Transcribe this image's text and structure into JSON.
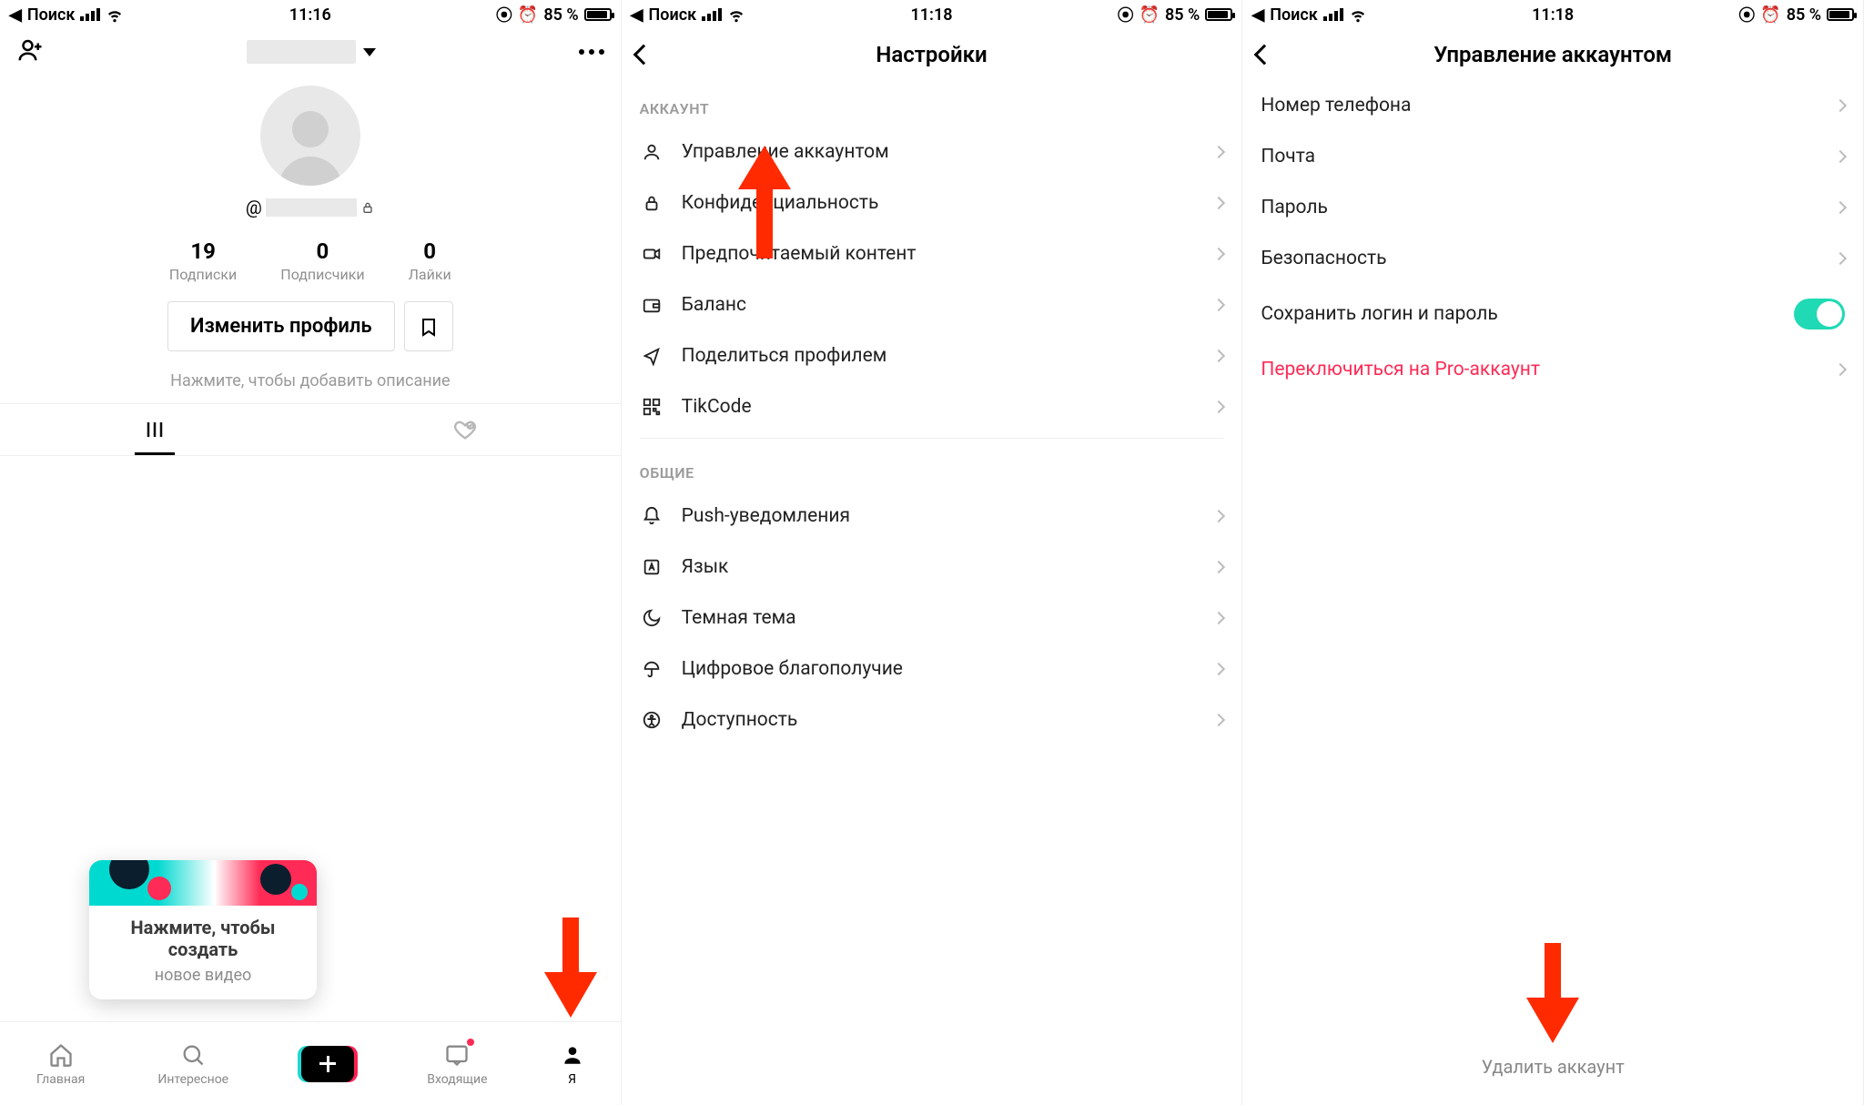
{
  "status": {
    "back_app": "Поиск",
    "battery_pct": "85 %",
    "s1_time": "11:16",
    "s2_time": "11:18",
    "s3_time": "11:18"
  },
  "s1": {
    "edit_profile": "Изменить профиль",
    "add_bio": "Нажмите, чтобы добавить описание",
    "handle_prefix": "@",
    "stats": {
      "following_num": "19",
      "following_lbl": "Подписки",
      "followers_num": "0",
      "followers_lbl": "Подписчики",
      "likes_num": "0",
      "likes_lbl": "Лайки"
    },
    "tip": {
      "line1a": "Нажмите, чтобы",
      "line1b": "создать",
      "line2": "новое видео"
    },
    "tabs": {
      "home": "Главная",
      "discover": "Интересное",
      "inbox": "Входящие",
      "me": "Я"
    }
  },
  "s2": {
    "title": "Настройки",
    "section_account": "АККАУНТ",
    "section_general": "ОБЩИЕ",
    "rows": {
      "manage": "Управление аккаунтом",
      "privacy": "Конфиденциальность",
      "content": "Предпочитаемый контент",
      "balance": "Баланс",
      "share": "Поделиться профилем",
      "tikcode": "TikCode",
      "push": "Push-уведомления",
      "lang": "Язык",
      "dark": "Темная тема",
      "wellbeing": "Цифровое благополучие",
      "access": "Доступность"
    }
  },
  "s3": {
    "title": "Управление аккаунтом",
    "rows": {
      "phone": "Номер телефона",
      "email": "Почта",
      "password": "Пароль",
      "security": "Безопасность",
      "save_login": "Сохранить логин и пароль",
      "pro": "Переключиться на Pro-аккаунт"
    },
    "delete": "Удалить аккаунт"
  }
}
